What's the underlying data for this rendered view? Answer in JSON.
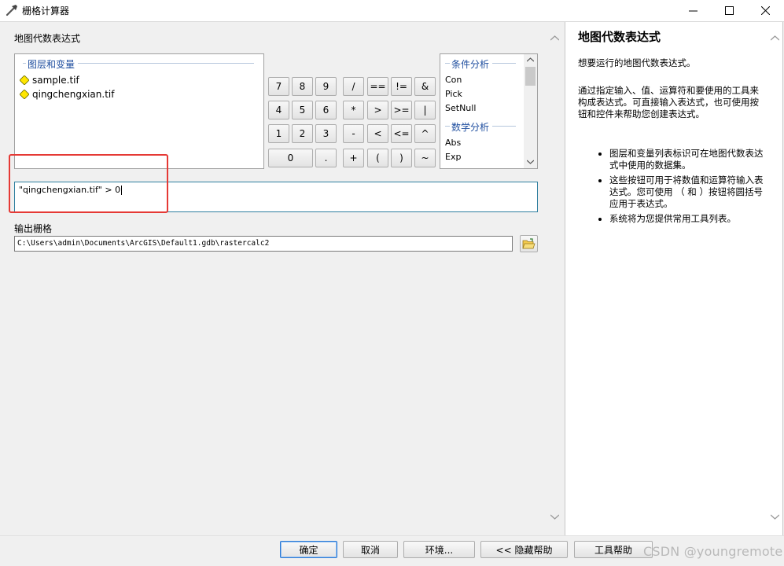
{
  "window": {
    "title": "栅格计算器"
  },
  "main": {
    "expression_label": "地图代数表达式",
    "layers_group_title": "图层和变量",
    "layers": [
      "sample.tif",
      "qingchengxian.tif"
    ],
    "calculator_buttons": [
      "7",
      "8",
      "9",
      "/",
      "==",
      "!=",
      "&",
      "4",
      "5",
      "6",
      "*",
      ">",
      ">=",
      "|",
      "1",
      "2",
      "3",
      "-",
      "<",
      "<=",
      "^",
      "0",
      ".",
      "+",
      "(",
      ")",
      "~"
    ],
    "tools_group_conditional": "条件分析",
    "tools_conditional": [
      "Con",
      "Pick",
      "SetNull"
    ],
    "tools_group_math": "数学分析",
    "tools_math": [
      "Abs",
      "Exp"
    ],
    "expression_value": "\"qingchengxian.tif\" > 0",
    "output_label": "输出栅格",
    "output_path": "C:\\Users\\admin\\Documents\\ArcGIS\\Default1.gdb\\rastercalc2"
  },
  "help": {
    "title": "地图代数表达式",
    "intro": "想要运行的地图代数表达式。",
    "para2": "通过指定输入、值、运算符和要使用的工具来构成表达式。可直接输入表达式，也可使用按钮和控件来帮助您创建表达式。",
    "bullets": [
      "图层和变量列表标识可在地图代数表达式中使用的数据集。",
      "这些按钮可用于将数值和运算符输入表达式。您可使用 （ 和 ）按钮将圆括号应用于表达式。",
      "系统将为您提供常用工具列表。"
    ]
  },
  "buttons": {
    "ok": "确定",
    "cancel": "取消",
    "environments": "环境...",
    "hide_help": "<< 隐藏帮助",
    "tool_help": "工具帮助"
  },
  "watermark": "CSDN @youngremote",
  "colors": {
    "highlight_rect": "#e53935",
    "group_title": "#1f4e9f",
    "layer_icon": "#ffe600"
  }
}
